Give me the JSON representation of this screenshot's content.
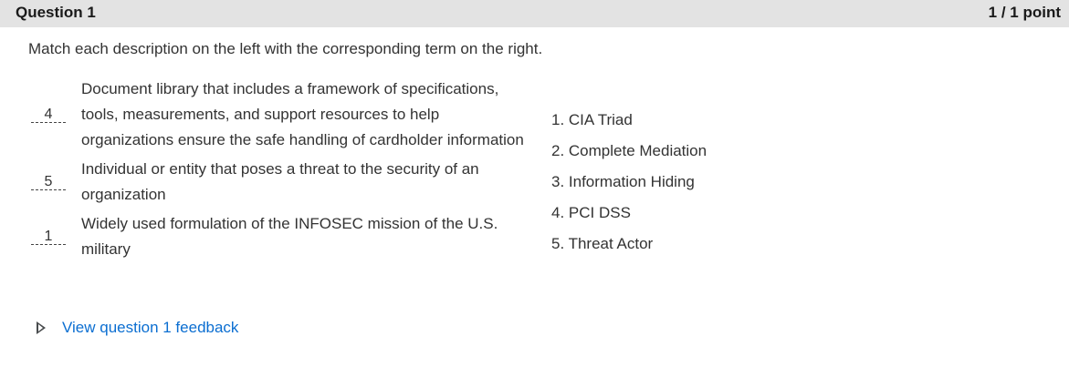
{
  "question": {
    "title": "Question 1",
    "score": "1 / 1 point",
    "prompt": "Match each description on the left with the corresponding term on the right."
  },
  "matches": [
    {
      "answer": "4",
      "description": "Document library that includes a framework of specifications, tools, measurements, and support resources to help organizations ensure the safe handling of cardholder information"
    },
    {
      "answer": "5",
      "description": "Individual or entity that poses a threat to the security of an organization"
    },
    {
      "answer": "1",
      "description": "Widely used formulation of the INFOSEC mission of the U.S. military"
    }
  ],
  "terms": [
    "1. CIA Triad",
    "2. Complete Mediation",
    "3. Information Hiding",
    "4. PCI DSS",
    "5. Threat Actor"
  ],
  "feedback": {
    "label": "View question 1 feedback"
  }
}
